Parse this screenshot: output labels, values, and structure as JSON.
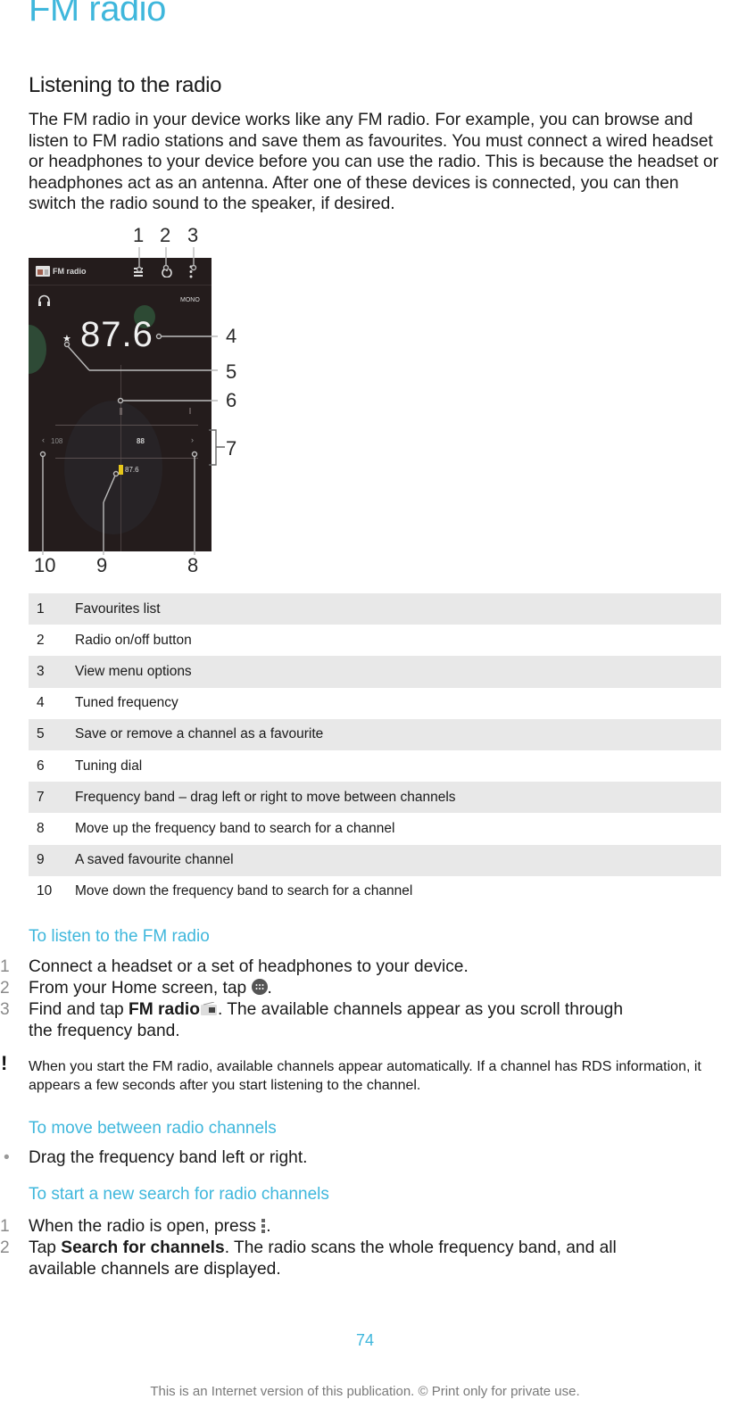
{
  "page": {
    "title": "FM radio",
    "section_title": "Listening to the radio",
    "intro": "The FM radio in your device works like any FM radio. For example, you can browse and listen to FM radio stations and save them as favourites. You must connect a wired headset or headphones to your device before you can use the radio. This is because the headset or headphones act as an antenna. After one of these devices is connected, you can then switch the radio sound to the speaker, if desired."
  },
  "diagram": {
    "app_title": "FM radio",
    "mono_label": "MONO",
    "frequency": "87.6",
    "band_left_label": "108",
    "band_center_label": "88",
    "favourite_label": "87.6",
    "callouts": [
      "1",
      "2",
      "3",
      "4",
      "5",
      "6",
      "7",
      "8",
      "9",
      "10"
    ],
    "icons": {
      "app": "radio-icon",
      "favourites": "list-icon",
      "power": "power-icon",
      "menu": "more-vert-icon",
      "headphones": "headphones-icon",
      "star": "star-icon"
    }
  },
  "legend": [
    {
      "num": "1",
      "text": "Favourites list"
    },
    {
      "num": "2",
      "text": "Radio on/off button"
    },
    {
      "num": "3",
      "text": "View menu options"
    },
    {
      "num": "4",
      "text": "Tuned frequency"
    },
    {
      "num": "5",
      "text": "Save or remove a channel as a favourite"
    },
    {
      "num": "6",
      "text": "Tuning dial"
    },
    {
      "num": "7",
      "text": "Frequency band – drag left or right to move between channels"
    },
    {
      "num": "8",
      "text": "Move up the frequency band to search for a channel"
    },
    {
      "num": "9",
      "text": "A saved favourite channel"
    },
    {
      "num": "10",
      "text": "Move down the frequency band to search for a channel"
    }
  ],
  "listen": {
    "heading": "To listen to the FM radio",
    "steps": [
      {
        "num": "1",
        "text": "Connect a headset or a set of headphones to your device."
      },
      {
        "num": "2",
        "pre": "From your Home screen, tap ",
        "post": "."
      },
      {
        "num": "3",
        "pre": "Find and tap ",
        "bold": "FM radio",
        "post": ". The available channels appear as you scroll through",
        "line2": "the frequency band."
      }
    ]
  },
  "note": {
    "icon": "!",
    "text": "When you start the FM radio, available channels appear automatically. If a channel has RDS information, it appears a few seconds after you start listening to the channel."
  },
  "move": {
    "heading": "To move between radio channels",
    "bullet": "•",
    "text": "Drag the frequency band left or right."
  },
  "search": {
    "heading": "To start a new search for radio channels",
    "steps": [
      {
        "num": "1",
        "pre": "When the radio is open, press ",
        "post": "."
      },
      {
        "num": "2",
        "pre": "Tap ",
        "bold": "Search for channels",
        "post": ". The radio scans the whole frequency band, and all",
        "line2": "available channels are displayed."
      }
    ]
  },
  "footer": {
    "page_number": "74",
    "notice": "This is an Internet version of this publication. © Print only for private use."
  },
  "colors": {
    "accent": "#3fb7dc",
    "table_stripe": "#e8e8e8",
    "phone_bg": "#241c1c",
    "favourite_marker": "#e6c619"
  }
}
